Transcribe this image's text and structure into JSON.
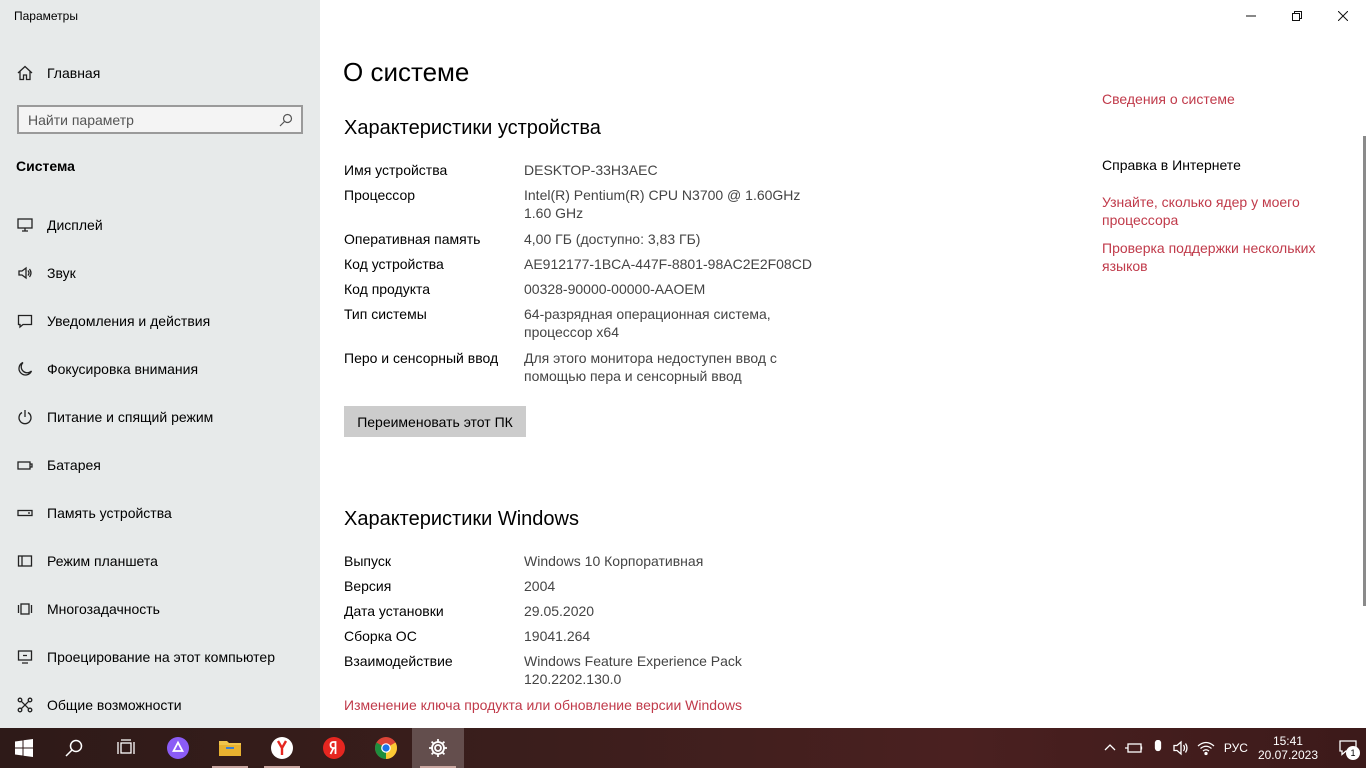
{
  "window": {
    "title": "Параметры"
  },
  "sidebar": {
    "home_label": "Главная",
    "search_placeholder": "Найти параметр",
    "section_label": "Система",
    "items": [
      {
        "label": "Дисплей",
        "icon": "monitor-icon"
      },
      {
        "label": "Звук",
        "icon": "speaker-icon"
      },
      {
        "label": "Уведомления и действия",
        "icon": "notification-icon"
      },
      {
        "label": "Фокусировка внимания",
        "icon": "moon-icon"
      },
      {
        "label": "Питание и спящий режим",
        "icon": "power-icon"
      },
      {
        "label": "Батарея",
        "icon": "battery-icon"
      },
      {
        "label": "Память устройства",
        "icon": "storage-icon"
      },
      {
        "label": "Режим планшета",
        "icon": "tablet-icon"
      },
      {
        "label": "Многозадачность",
        "icon": "multitask-icon"
      },
      {
        "label": "Проецирование на этот компьютер",
        "icon": "project-icon"
      },
      {
        "label": "Общие возможности",
        "icon": "shared-icon"
      }
    ]
  },
  "main": {
    "page_title": "О системе",
    "device_heading": "Характеристики устройства",
    "device_specs": [
      {
        "key": "Имя устройства",
        "value": "DESKTOP-33H3AEC"
      },
      {
        "key": "Процессор",
        "value": "Intel(R) Pentium(R) CPU  N3700  @ 1.60GHz\n1.60 GHz"
      },
      {
        "key": "Оперативная память",
        "value": "4,00 ГБ (доступно: 3,83 ГБ)"
      },
      {
        "key": "Код устройства",
        "value": "AE912177-1BCA-447F-8801-98AC2E2F08CD"
      },
      {
        "key": "Код продукта",
        "value": "00328-90000-00000-AAOEM"
      },
      {
        "key": "Тип системы",
        "value": "64-разрядная операционная система,\nпроцессор x64"
      },
      {
        "key": "Перо и сенсорный ввод",
        "value": "Для этого монитора недоступен ввод с\nпомощью пера и сенсорный ввод"
      }
    ],
    "rename_button": "Переименовать этот ПК",
    "windows_heading": "Характеристики Windows",
    "windows_specs": [
      {
        "key": "Выпуск",
        "value": "Windows 10 Корпоративная"
      },
      {
        "key": "Версия",
        "value": "2004"
      },
      {
        "key": "Дата установки",
        "value": "29.05.2020"
      },
      {
        "key": "Сборка ОС",
        "value": "19041.264"
      },
      {
        "key": "Взаимодействие",
        "value": "Windows Feature Experience Pack\n120.2202.130.0"
      }
    ],
    "change_key_link": "Изменение ключа продукта или обновление версии Windows"
  },
  "related": {
    "system_info_link": "Сведения о системе",
    "help_heading": "Справка в Интернете",
    "help_links": [
      "Узнайте, сколько ядер у моего\nпроцессора",
      "Проверка поддержки нескольких\nязыков"
    ]
  },
  "taskbar": {
    "language": "РУС",
    "time": "15:41",
    "date": "20.07.2023",
    "notification_count": "1",
    "apps": [
      "start-icon",
      "search-icon",
      "task-view-icon",
      "alice-icon",
      "file-explorer-icon",
      "yandex-browser-icon",
      "yandex-icon",
      "chrome-icon",
      "settings-icon"
    ]
  },
  "colors": {
    "link": "#c03a4a",
    "sidebar_bg": "#e7eaea"
  }
}
